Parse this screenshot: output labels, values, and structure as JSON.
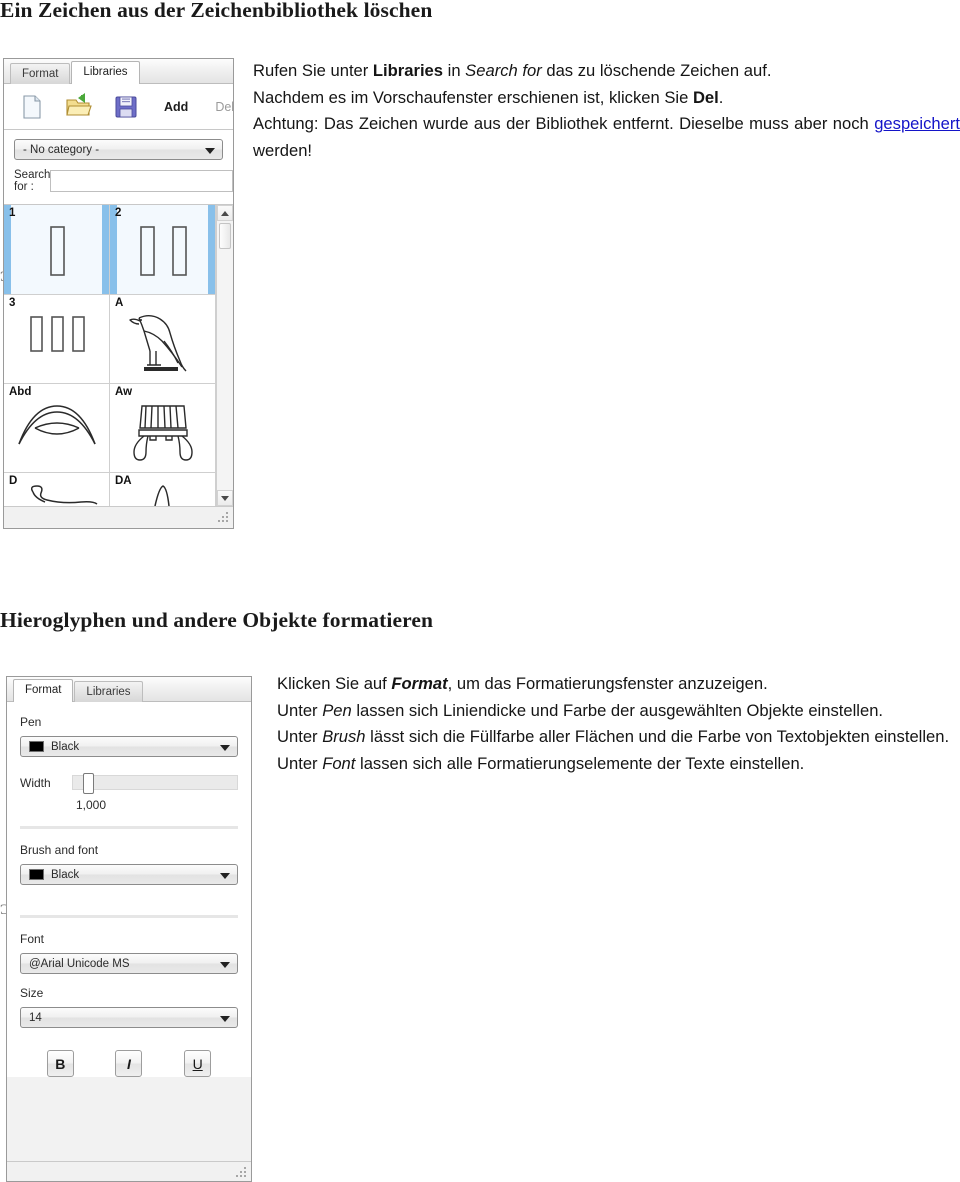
{
  "document": {
    "section1": {
      "heading": "Ein Zeichen aus der Zeichenbibliothek löschen",
      "paragraph": {
        "l1_a": "Rufen Sie unter ",
        "l1_b": "Libraries",
        "l1_c": " in ",
        "l1_d": "Search for",
        "l1_e": " das zu löschende Zeichen auf.",
        "l2_a": "Nachdem es im Vorschaufenster erschienen ist, klicken Sie ",
        "l2_b": "Del",
        "l2_c": ".",
        "l3_a": "Achtung: Das Zeichen wurde aus der Bibliothek entfernt. Dieselbe muss aber noch ",
        "l3_b": "gespeichert",
        "l3_c": " werden!"
      }
    },
    "section2": {
      "heading": "Hieroglyphen und andere Objekte formatieren",
      "paragraph": {
        "l1_a": "Klicken Sie auf ",
        "l1_b": "Format",
        "l1_c": ", um das Formatierungsfenster anzuzeigen.",
        "l2_a": "Unter ",
        "l2_b": "Pen",
        "l2_c": " lassen sich Liniendicke und Farbe der ausgewählten Objekte einstellen.",
        "l3_a": "Unter ",
        "l3_b": "Brush",
        "l3_c": " lässt sich die Füllfarbe aller Flächen und die Farbe von Textobjekten einstellen.",
        "l4_a": "Unter ",
        "l4_b": "Font",
        "l4_c": " lassen sich alle Formatierungselemente der Texte einstellen."
      }
    }
  },
  "libraries_panel": {
    "tabs": [
      {
        "label": "Format",
        "active": false
      },
      {
        "label": "Libraries",
        "active": true
      }
    ],
    "toolbar": {
      "new_icon": "new-document-icon",
      "open_icon": "open-folder-icon",
      "save_icon": "save-floppy-icon",
      "add_label": "Add",
      "del_label": "Del"
    },
    "category_combo": {
      "value": "- No category -",
      "arrow_icon": "chevron-down-icon"
    },
    "search": {
      "label": "Search for :",
      "value": "",
      "placeholder": ""
    },
    "glyph_grid": {
      "cells": [
        {
          "caption": "1",
          "selected": true,
          "art": "one-stroke"
        },
        {
          "caption": "2",
          "selected": true,
          "art": "two-strokes"
        },
        {
          "caption": "3",
          "selected": false,
          "art": "three-strokes"
        },
        {
          "caption": "A",
          "selected": false,
          "art": "vulture"
        },
        {
          "caption": "Abd",
          "selected": false,
          "art": "crescent-arc"
        },
        {
          "caption": "Aw",
          "selected": false,
          "art": "comb-stand"
        },
        {
          "caption": "D",
          "selected": false,
          "art": "serpent"
        },
        {
          "caption": "DA",
          "selected": false,
          "art": "peak"
        }
      ]
    },
    "scrollbar": {
      "up_icon": "scroll-up-arrow-icon",
      "down_icon": "scroll-down-arrow-icon",
      "thumb": "scrollbar-thumb"
    },
    "statusbar": {
      "grip_icon": "resize-grip-icon"
    }
  },
  "format_panel": {
    "tabs": [
      {
        "label": "Format",
        "active": true
      },
      {
        "label": "Libraries",
        "active": false
      }
    ],
    "pen": {
      "label": "Pen",
      "color_value": "Black",
      "color_hex": "#000000",
      "arrow_icon": "chevron-down-icon"
    },
    "width": {
      "label": "Width",
      "value": "1,000"
    },
    "brush": {
      "label": "Brush and font",
      "color_value": "Black",
      "color_hex": "#000000",
      "arrow_icon": "chevron-down-icon"
    },
    "font": {
      "label": "Font",
      "value": "@Arial Unicode MS",
      "arrow_icon": "chevron-down-icon"
    },
    "size": {
      "label": "Size",
      "value": "14",
      "arrow_icon": "chevron-down-icon"
    },
    "style_buttons": [
      {
        "label": "B",
        "name": "bold-button"
      },
      {
        "label": "I",
        "name": "italic-button"
      },
      {
        "label": "U",
        "name": "underline-button"
      }
    ],
    "statusbar": {
      "grip_icon": "resize-grip-icon"
    }
  },
  "edge_marks": {
    "glyph": "Ɔ"
  }
}
